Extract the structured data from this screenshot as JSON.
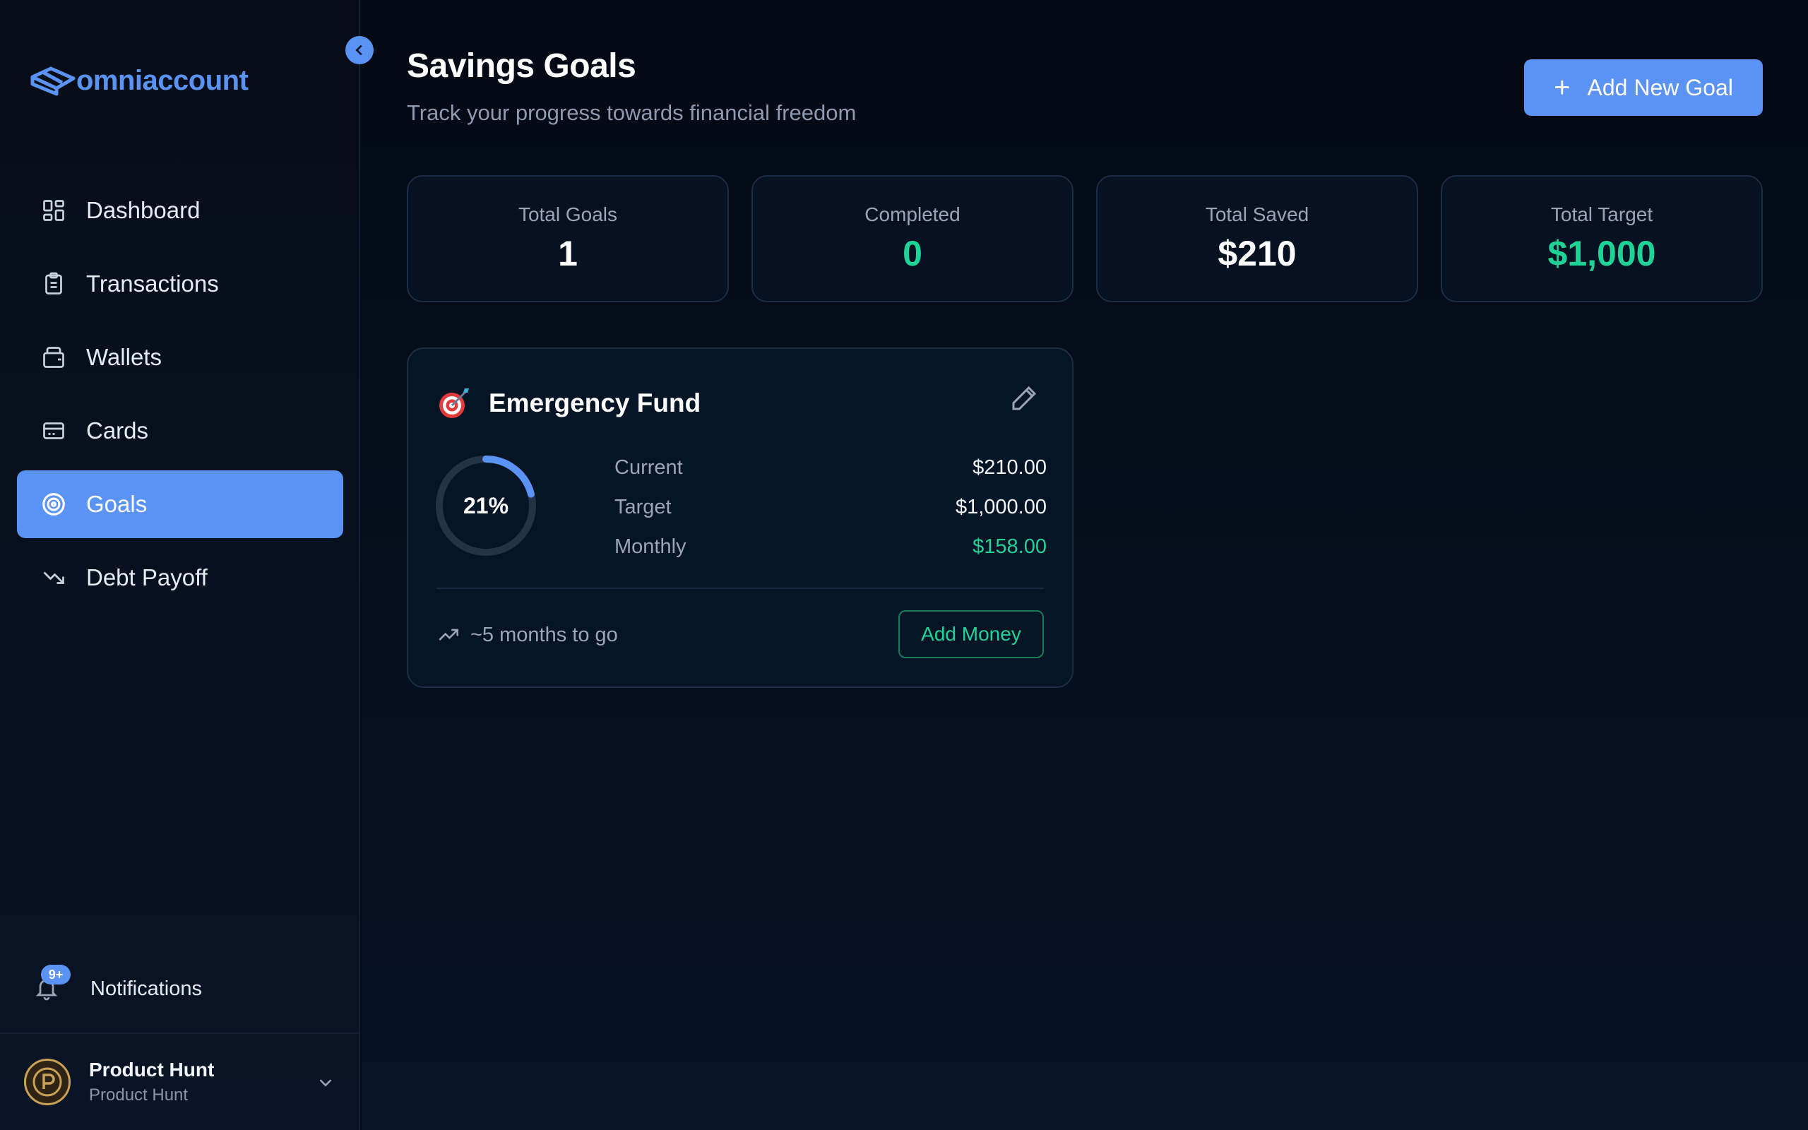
{
  "brand": {
    "name": "omniaccount",
    "color": "#5b93f5"
  },
  "sidebar": {
    "items": [
      {
        "label": "Dashboard",
        "icon": "grid-icon"
      },
      {
        "label": "Transactions",
        "icon": "clipboard-icon"
      },
      {
        "label": "Wallets",
        "icon": "wallet-icon"
      },
      {
        "label": "Cards",
        "icon": "card-icon"
      },
      {
        "label": "Goals",
        "icon": "target-icon",
        "active": true
      },
      {
        "label": "Debt Payoff",
        "icon": "trending-down-icon"
      }
    ],
    "notifications": {
      "label": "Notifications",
      "badge": "9+"
    },
    "user": {
      "name": "Product Hunt",
      "sub": "Product Hunt"
    }
  },
  "header": {
    "title": "Savings Goals",
    "subtitle": "Track your progress towards financial freedom",
    "add_button": "Add New Goal"
  },
  "stats": [
    {
      "label": "Total Goals",
      "value": "1"
    },
    {
      "label": "Completed",
      "value": "0"
    },
    {
      "label": "Total Saved",
      "value": "$210"
    },
    {
      "label": "Total Target",
      "value": "$1,000"
    }
  ],
  "goal": {
    "name": "Emergency Fund",
    "emoji": "🎯",
    "percent_label": "21%",
    "progress": 0.21,
    "rows": [
      {
        "label": "Current",
        "value": "$210.00"
      },
      {
        "label": "Target",
        "value": "$1,000.00"
      },
      {
        "label": "Monthly",
        "value": "$158.00"
      }
    ],
    "eta": "~5 months to go",
    "add_money": "Add Money"
  },
  "colors": {
    "accent": "#5b93f5",
    "success": "#1ed396",
    "ring_track": "#243246"
  }
}
